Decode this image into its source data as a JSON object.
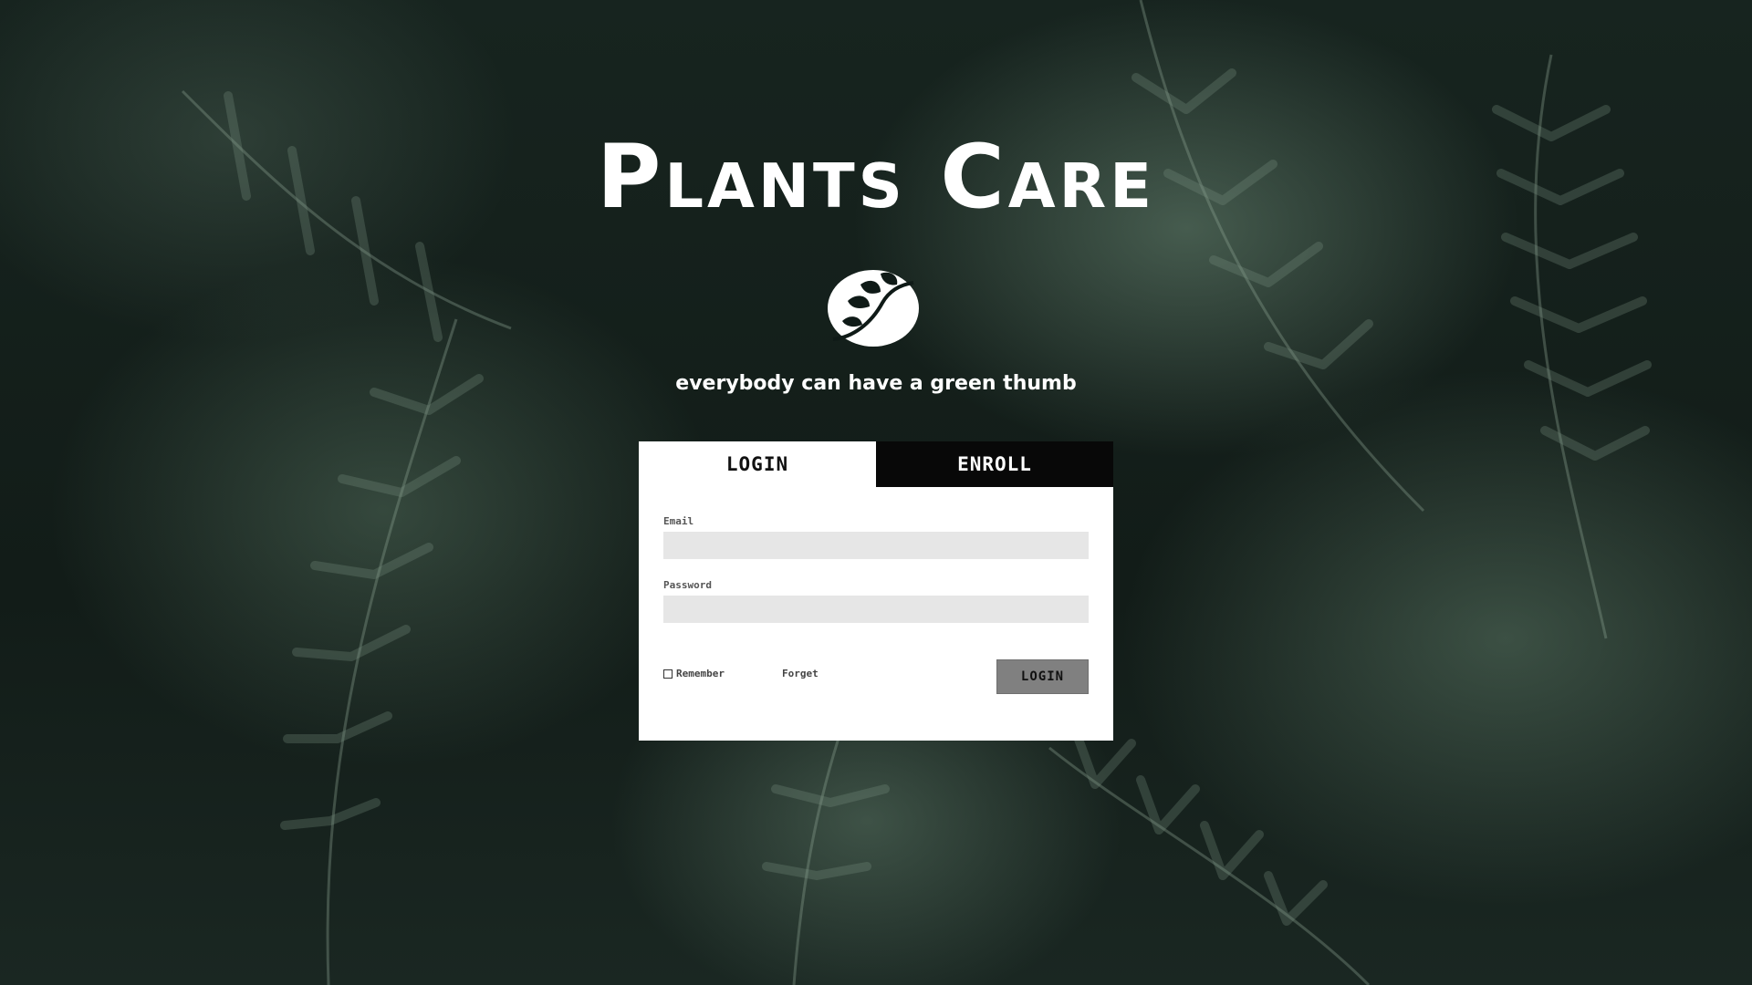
{
  "app": {
    "title": "Plants Care",
    "tagline": "everybody can have a green thumb",
    "logo_icon": "leaf-icon"
  },
  "tabs": [
    {
      "label": "LOGIN",
      "active": true
    },
    {
      "label": "ENROLL",
      "active": false
    }
  ],
  "form": {
    "email_label": "Email",
    "email_value": "",
    "password_label": "Password",
    "password_value": "",
    "remember_label": "Remember",
    "remember_checked": false,
    "forget_label": "Forget",
    "submit_label": "LOGIN"
  },
  "colors": {
    "panel": "#ffffff",
    "tab_inactive": "#080808",
    "input_bg": "#e6e6e6",
    "button_bg": "#808080"
  }
}
